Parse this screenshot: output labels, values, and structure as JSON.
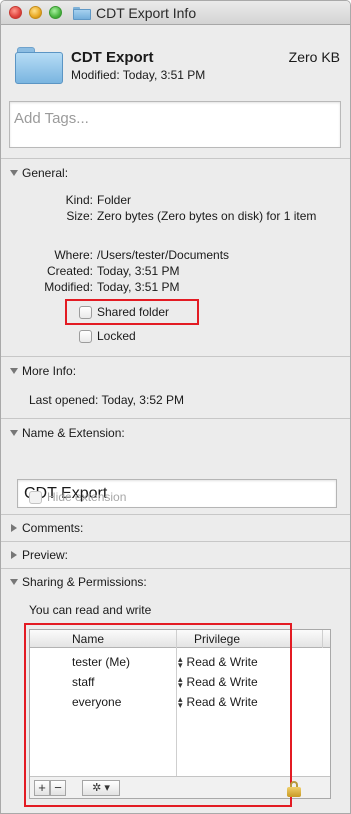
{
  "window": {
    "title": "CDT Export Info"
  },
  "header": {
    "name": "CDT Export",
    "size": "Zero KB",
    "modified": "Modified: Today, 3:51 PM"
  },
  "tags": {
    "placeholder": "Add Tags..."
  },
  "general": {
    "label": "General:",
    "rows": [
      {
        "key": "Kind:",
        "value": "Folder"
      },
      {
        "key": "Size:",
        "value": "Zero bytes (Zero bytes on disk) for 1 item"
      },
      {
        "key": "Where:",
        "value": "/Users/tester/Documents"
      },
      {
        "key": "Created:",
        "value": "Today, 3:51 PM"
      },
      {
        "key": "Modified:",
        "value": "Today, 3:51 PM"
      }
    ],
    "shared_folder": "Shared folder",
    "locked": "Locked"
  },
  "more_info": {
    "label": "More Info:",
    "last_opened": "Last opened: Today, 3:52 PM"
  },
  "name_extension": {
    "label": "Name & Extension:",
    "value": "CDT Export",
    "hide_extension": "Hide extension"
  },
  "comments": {
    "label": "Comments:"
  },
  "preview": {
    "label": "Preview:"
  },
  "sharing": {
    "label": "Sharing & Permissions:",
    "status": "You can read and write",
    "columns": {
      "name": "Name",
      "privilege": "Privilege"
    },
    "rows": [
      {
        "name": "tester (Me)",
        "privilege": "Read & Write",
        "icon": "user-icon"
      },
      {
        "name": "staff",
        "privilege": "Read & Write",
        "icon": "group-icon"
      },
      {
        "name": "everyone",
        "privilege": "Read & Write",
        "icon": "everyone-icon"
      }
    ],
    "buttons": {
      "add": "+",
      "remove": "−",
      "action": "✲ ▾"
    }
  },
  "colors": {
    "highlight_box": "#e31b23",
    "folder_blue": "#7ab5e0"
  }
}
